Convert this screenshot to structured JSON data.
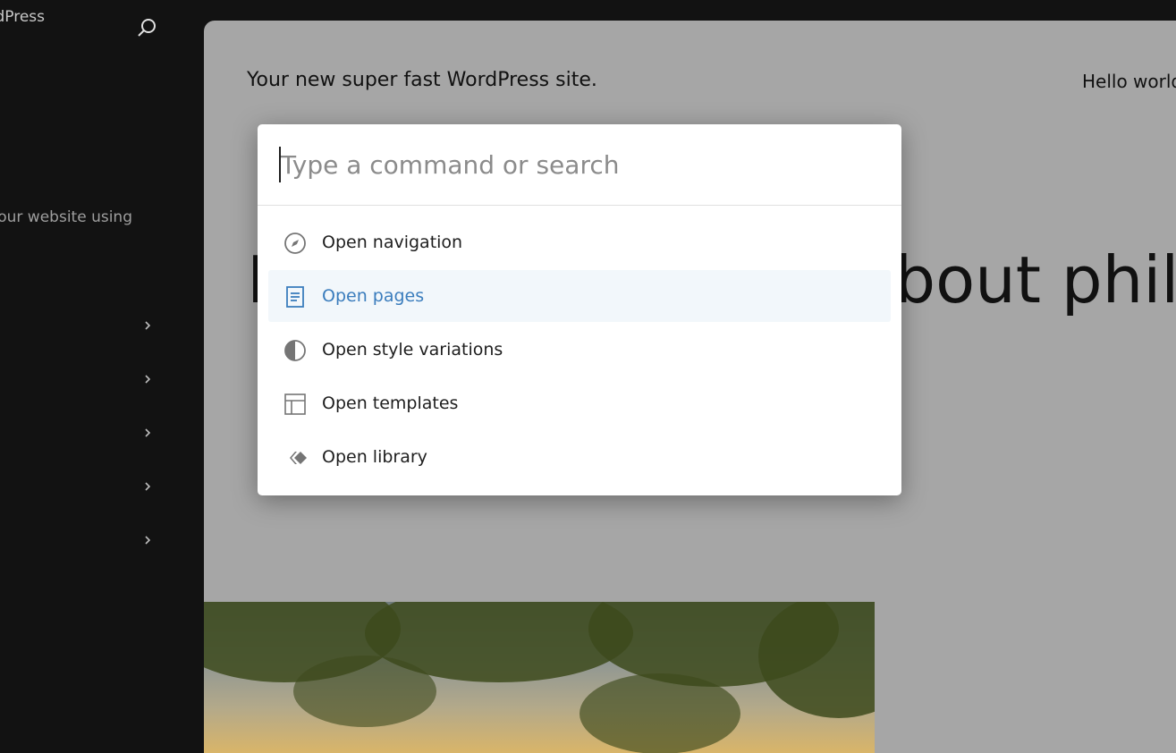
{
  "sidebar": {
    "title": "WordPress",
    "description": "Customize the look of your website using",
    "search_icon": "search-icon",
    "items": [
      {
        "icon": "chevron-right-icon"
      },
      {
        "icon": "chevron-right-icon"
      },
      {
        "icon": "chevron-right-icon"
      },
      {
        "icon": "chevron-right-icon"
      },
      {
        "icon": "chevron-right-icon"
      }
    ]
  },
  "preview": {
    "site_title": "Your new super fast WordPress site.",
    "nav_item": "Hello world!",
    "heading": "Mindblown: a blog about philosophy."
  },
  "command_palette": {
    "placeholder": "Type a command or search",
    "commands": [
      {
        "label": "Open navigation",
        "icon": "compass-icon",
        "active": false
      },
      {
        "label": "Open pages",
        "icon": "page-icon",
        "active": true
      },
      {
        "label": "Open style variations",
        "icon": "contrast-icon",
        "active": false
      },
      {
        "label": "Open templates",
        "icon": "layout-icon",
        "active": false
      },
      {
        "label": "Open library",
        "icon": "symbol-icon",
        "active": false
      }
    ]
  },
  "colors": {
    "sidebar_bg": "#121212",
    "canvas_bg": "#a6a6a6",
    "accent": "#3b7dbd",
    "active_row_bg": "#f2f7fb"
  }
}
